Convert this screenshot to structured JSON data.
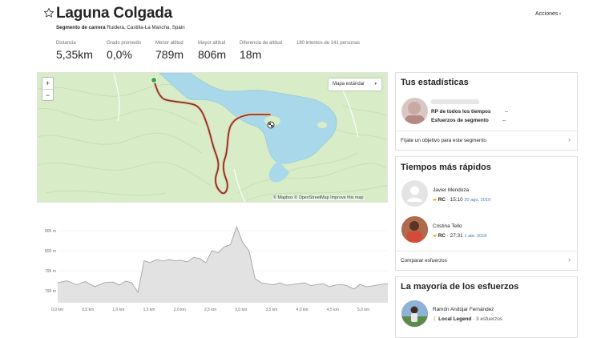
{
  "segment": {
    "title": "Laguna Colgada",
    "type": "Segmento de carrera",
    "location": "Ruidera, Castilla-La Mancha, Spain"
  },
  "header": {
    "actions_label": "Acciones",
    "actions_chevron": "˅"
  },
  "stats": [
    {
      "label": "Distancia",
      "value": "5,35km"
    },
    {
      "label": "Grado promedio",
      "value": "0,0%"
    },
    {
      "label": "Menor altitud",
      "value": "789m"
    },
    {
      "label": "Mayor altitud",
      "value": "806m"
    },
    {
      "label": "Diferencia de altitud",
      "value": "18m"
    }
  ],
  "attempts_text": "180 intentos de 141 personas",
  "map": {
    "zoom_in": "+",
    "zoom_out": "−",
    "style_label": "Mapa estándar",
    "style_caret": "▾",
    "attribution": "© Mapbox © OpenStreetMap Improve this map"
  },
  "elevation": {
    "y_ticks": [
      "805 m",
      "800 m",
      "795 m",
      "790 m"
    ],
    "x_ticks": [
      "0,0 km",
      "0,5 km",
      "1,0 km",
      "1,5 km",
      "2,0 km",
      "2,5 km",
      "3,0 km",
      "3,5 km",
      "4,0 km",
      "4,5 km",
      "5,0 km"
    ],
    "profile_km": [
      0,
      0.15,
      0.3,
      0.45,
      0.6,
      0.75,
      0.9,
      1.0,
      1.1,
      1.2,
      1.3,
      1.4,
      1.5,
      1.6,
      1.7,
      1.8,
      1.9,
      2.0,
      2.1,
      2.2,
      2.3,
      2.4,
      2.5,
      2.6,
      2.7,
      2.8,
      2.9,
      3.0,
      3.1,
      3.2,
      3.3,
      3.4,
      3.5,
      3.6,
      3.7,
      3.8,
      3.9,
      4.0,
      4.1,
      4.2,
      4.3,
      4.4,
      4.5,
      4.6,
      4.7,
      4.8,
      4.9,
      5.0,
      5.1,
      5.2,
      5.35
    ],
    "profile_m": [
      792,
      792.5,
      791.5,
      792.3,
      791.0,
      792.0,
      792.2,
      791.4,
      792.4,
      792.0,
      789.6,
      797.5,
      797.0,
      797.8,
      797.4,
      797.8,
      797.5,
      797.6,
      797.2,
      798.3,
      798.1,
      797.0,
      800.0,
      799.5,
      801.0,
      801.5,
      806.0,
      802.0,
      800.0,
      793.0,
      792.0,
      791.7,
      791.5,
      792.0,
      791.4,
      791.5,
      791.8,
      792.0,
      791.3,
      791.5,
      791.8,
      791.0,
      791.4,
      791.6,
      791.2,
      790.4,
      791.6,
      791.0,
      791.2,
      791.5,
      791.8
    ]
  },
  "card_stats": {
    "title": "Tus estadísticas",
    "pr_label": "RP de todos los tiempos",
    "pr_value": "--",
    "efforts_label": "Esfuerzos de segmento",
    "efforts_value": "--",
    "goal_text": "Fíjate un objetivo para este segmento"
  },
  "card_fastest": {
    "title": "Tiempos más rápidos",
    "entries": [
      {
        "name": "Javier Mendoza",
        "badge": "RC",
        "sep": "·",
        "time": "15:10",
        "date": "20 ago. 2019"
      },
      {
        "name": "Cristina Tello",
        "badge": "RC",
        "sep": "·",
        "time": "27:31",
        "date": "1 abr. 2018"
      }
    ],
    "compare_label": "Comparar esfuerzos"
  },
  "card_most": {
    "title": "La mayoría de los esfuerzos",
    "name": "Ramón Andújar Fernández",
    "legend_label": "Local Legend",
    "sep": "·",
    "efforts": "3 esfuerzos"
  },
  "colors": {
    "text": "#242428",
    "route": "#7a3a1e",
    "route_outline": "#f2c9b6",
    "water": "#a8d8ea",
    "land": "#d7ecc7",
    "trophy": "#e3b63b",
    "date_link": "#4a7ac7",
    "elevation_fill": "#e2e2e2",
    "elevation_line": "#9a9a9a"
  }
}
